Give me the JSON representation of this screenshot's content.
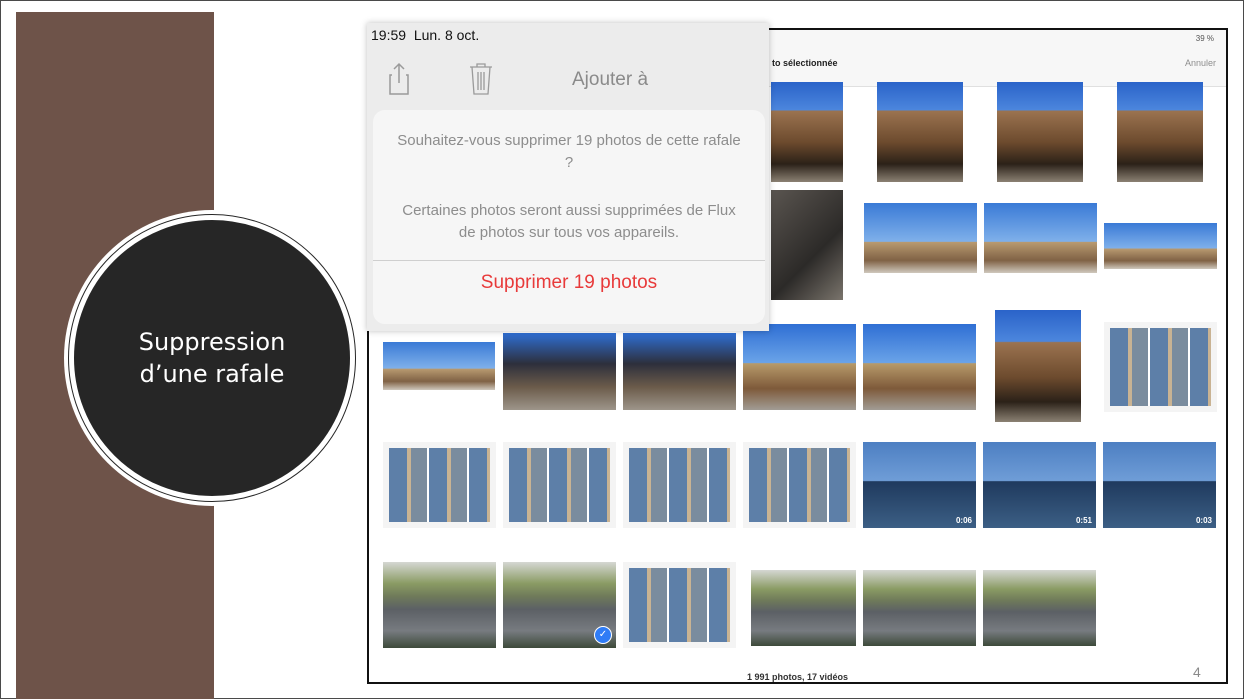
{
  "slide": {
    "title_line1": "Suppression",
    "title_line2": "d’une rafale",
    "page_number": "4"
  },
  "photos_app": {
    "header_title": "to sélectionnée",
    "cancel_label": "Annuler",
    "status_right": "39 %",
    "footer_count": "1 991 photos, 17 vidéos",
    "video_durations": [
      "0:06",
      "0:51",
      "0:03"
    ]
  },
  "action_sheet": {
    "time": "19:59",
    "date": "Lun. 8 oct.",
    "add_to_label": "Ajouter à",
    "message": "Souhaitez-vous supprimer 19 photos de cette rafale ?",
    "info": "Certaines photos seront aussi supprimées de Flux de photos sur tous vos appareils.",
    "delete_label": "Supprimer 19 photos"
  },
  "colors": {
    "side_band": "#6e5349",
    "circle": "#262626",
    "destructive": "#e83a3a",
    "selection_check": "#2f7cf6"
  }
}
